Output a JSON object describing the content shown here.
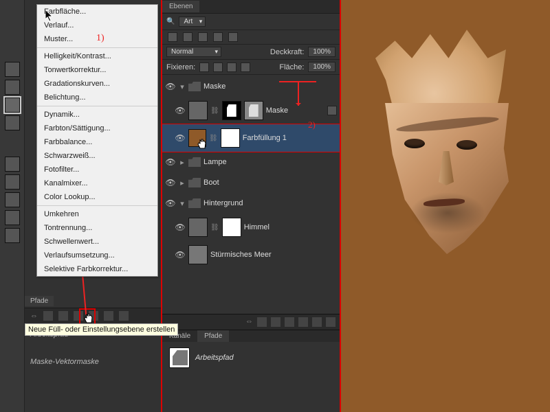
{
  "context_menu": {
    "items": [
      "Farbfläche...",
      "Verlauf...",
      "Muster...",
      "-",
      "Helligkeit/Kontrast...",
      "Tonwertkorrektur...",
      "Gradationskurven...",
      "Belichtung...",
      "-",
      "Dynamik...",
      "Farbton/Sättigung...",
      "Farbbalance...",
      "Schwarzweiß...",
      "Fotofilter...",
      "Kanalmixer...",
      "Color Lookup...",
      "-",
      "Umkehren",
      "Tontrennung...",
      "Schwellenwert...",
      "Verlaufsumsetzung...",
      "Selektive Farbkorrektur..."
    ]
  },
  "annotations": {
    "step1": "1)",
    "step2": "2)"
  },
  "layers_panel": {
    "tab": "Ebenen",
    "filter_label": "Art",
    "blend_mode": "Normal",
    "opacity_label": "Deckkraft:",
    "opacity_value": "100%",
    "lock_label": "Fixieren:",
    "fill_label": "Fläche:",
    "fill_value": "100%",
    "layers": [
      {
        "type": "group",
        "name": "Maske"
      },
      {
        "type": "masked",
        "name": "Maske"
      },
      {
        "type": "fill",
        "name": "Farbfüllung 1",
        "selected": true
      },
      {
        "type": "group",
        "name": "Lampe"
      },
      {
        "type": "group",
        "name": "Boot"
      },
      {
        "type": "group",
        "name": "Hintergrund",
        "expanded": true
      },
      {
        "type": "masked",
        "name": "Himmel"
      },
      {
        "type": "smart",
        "name": "Stürmisches Meer"
      }
    ]
  },
  "paths_panel": {
    "tab_channels": "Kanäle",
    "tab_paths": "Pfade",
    "item": "Arbeitspfad"
  },
  "mid_lower": {
    "pfade_tab": "Pfade",
    "tooltip": "Neue Füll- oder Einstellungsebene erstellen",
    "path_name": "Arbeitspfad",
    "mask_name": "Maske-Vektormaske"
  }
}
